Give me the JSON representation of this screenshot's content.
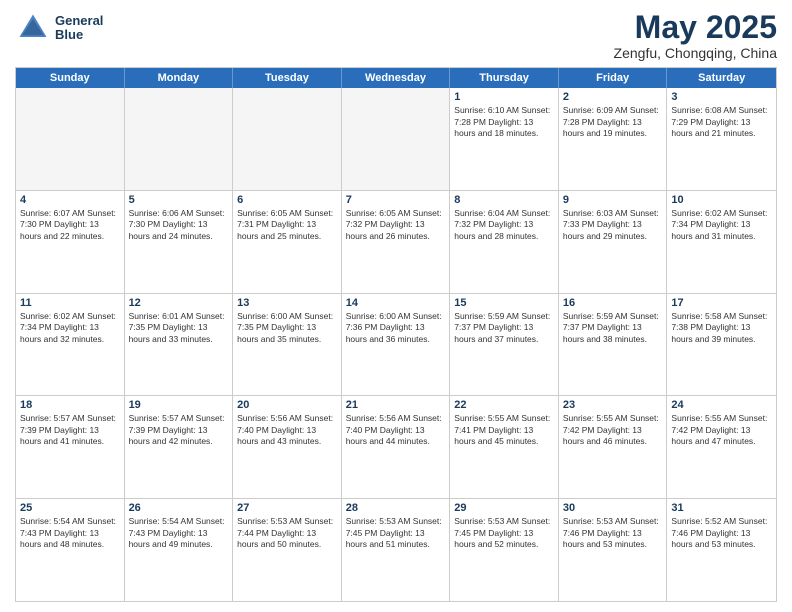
{
  "header": {
    "logo_line1": "General",
    "logo_line2": "Blue",
    "month": "May 2025",
    "location": "Zengfu, Chongqing, China"
  },
  "days_of_week": [
    "Sunday",
    "Monday",
    "Tuesday",
    "Wednesday",
    "Thursday",
    "Friday",
    "Saturday"
  ],
  "weeks": [
    [
      {
        "day": null,
        "info": null
      },
      {
        "day": null,
        "info": null
      },
      {
        "day": null,
        "info": null
      },
      {
        "day": null,
        "info": null
      },
      {
        "day": "1",
        "info": "Sunrise: 6:10 AM\nSunset: 7:28 PM\nDaylight: 13 hours\nand 18 minutes."
      },
      {
        "day": "2",
        "info": "Sunrise: 6:09 AM\nSunset: 7:28 PM\nDaylight: 13 hours\nand 19 minutes."
      },
      {
        "day": "3",
        "info": "Sunrise: 6:08 AM\nSunset: 7:29 PM\nDaylight: 13 hours\nand 21 minutes."
      }
    ],
    [
      {
        "day": "4",
        "info": "Sunrise: 6:07 AM\nSunset: 7:30 PM\nDaylight: 13 hours\nand 22 minutes."
      },
      {
        "day": "5",
        "info": "Sunrise: 6:06 AM\nSunset: 7:30 PM\nDaylight: 13 hours\nand 24 minutes."
      },
      {
        "day": "6",
        "info": "Sunrise: 6:05 AM\nSunset: 7:31 PM\nDaylight: 13 hours\nand 25 minutes."
      },
      {
        "day": "7",
        "info": "Sunrise: 6:05 AM\nSunset: 7:32 PM\nDaylight: 13 hours\nand 26 minutes."
      },
      {
        "day": "8",
        "info": "Sunrise: 6:04 AM\nSunset: 7:32 PM\nDaylight: 13 hours\nand 28 minutes."
      },
      {
        "day": "9",
        "info": "Sunrise: 6:03 AM\nSunset: 7:33 PM\nDaylight: 13 hours\nand 29 minutes."
      },
      {
        "day": "10",
        "info": "Sunrise: 6:02 AM\nSunset: 7:34 PM\nDaylight: 13 hours\nand 31 minutes."
      }
    ],
    [
      {
        "day": "11",
        "info": "Sunrise: 6:02 AM\nSunset: 7:34 PM\nDaylight: 13 hours\nand 32 minutes."
      },
      {
        "day": "12",
        "info": "Sunrise: 6:01 AM\nSunset: 7:35 PM\nDaylight: 13 hours\nand 33 minutes."
      },
      {
        "day": "13",
        "info": "Sunrise: 6:00 AM\nSunset: 7:35 PM\nDaylight: 13 hours\nand 35 minutes."
      },
      {
        "day": "14",
        "info": "Sunrise: 6:00 AM\nSunset: 7:36 PM\nDaylight: 13 hours\nand 36 minutes."
      },
      {
        "day": "15",
        "info": "Sunrise: 5:59 AM\nSunset: 7:37 PM\nDaylight: 13 hours\nand 37 minutes."
      },
      {
        "day": "16",
        "info": "Sunrise: 5:59 AM\nSunset: 7:37 PM\nDaylight: 13 hours\nand 38 minutes."
      },
      {
        "day": "17",
        "info": "Sunrise: 5:58 AM\nSunset: 7:38 PM\nDaylight: 13 hours\nand 39 minutes."
      }
    ],
    [
      {
        "day": "18",
        "info": "Sunrise: 5:57 AM\nSunset: 7:39 PM\nDaylight: 13 hours\nand 41 minutes."
      },
      {
        "day": "19",
        "info": "Sunrise: 5:57 AM\nSunset: 7:39 PM\nDaylight: 13 hours\nand 42 minutes."
      },
      {
        "day": "20",
        "info": "Sunrise: 5:56 AM\nSunset: 7:40 PM\nDaylight: 13 hours\nand 43 minutes."
      },
      {
        "day": "21",
        "info": "Sunrise: 5:56 AM\nSunset: 7:40 PM\nDaylight: 13 hours\nand 44 minutes."
      },
      {
        "day": "22",
        "info": "Sunrise: 5:55 AM\nSunset: 7:41 PM\nDaylight: 13 hours\nand 45 minutes."
      },
      {
        "day": "23",
        "info": "Sunrise: 5:55 AM\nSunset: 7:42 PM\nDaylight: 13 hours\nand 46 minutes."
      },
      {
        "day": "24",
        "info": "Sunrise: 5:55 AM\nSunset: 7:42 PM\nDaylight: 13 hours\nand 47 minutes."
      }
    ],
    [
      {
        "day": "25",
        "info": "Sunrise: 5:54 AM\nSunset: 7:43 PM\nDaylight: 13 hours\nand 48 minutes."
      },
      {
        "day": "26",
        "info": "Sunrise: 5:54 AM\nSunset: 7:43 PM\nDaylight: 13 hours\nand 49 minutes."
      },
      {
        "day": "27",
        "info": "Sunrise: 5:53 AM\nSunset: 7:44 PM\nDaylight: 13 hours\nand 50 minutes."
      },
      {
        "day": "28",
        "info": "Sunrise: 5:53 AM\nSunset: 7:45 PM\nDaylight: 13 hours\nand 51 minutes."
      },
      {
        "day": "29",
        "info": "Sunrise: 5:53 AM\nSunset: 7:45 PM\nDaylight: 13 hours\nand 52 minutes."
      },
      {
        "day": "30",
        "info": "Sunrise: 5:53 AM\nSunset: 7:46 PM\nDaylight: 13 hours\nand 53 minutes."
      },
      {
        "day": "31",
        "info": "Sunrise: 5:52 AM\nSunset: 7:46 PM\nDaylight: 13 hours\nand 53 minutes."
      }
    ]
  ]
}
